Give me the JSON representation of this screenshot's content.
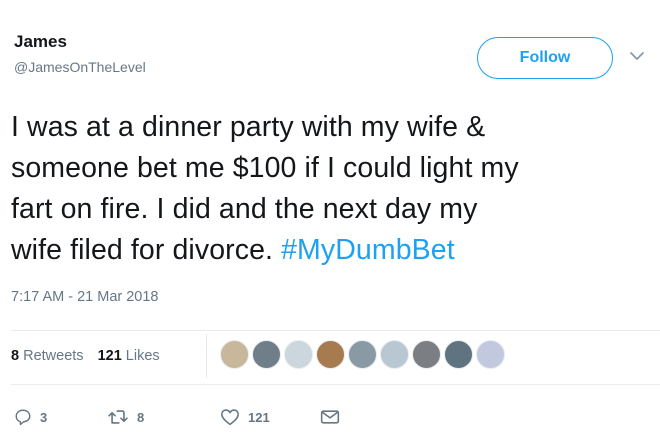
{
  "tweet": {
    "display_name": "James",
    "handle": "@JamesOnTheLevel",
    "follow_label": "Follow",
    "text_lines": [
      "I was at a dinner party with my wife &",
      "someone bet me $100 if I could light my",
      "fart on fire. I did and the next day my",
      "wife filed for divorce. "
    ],
    "hashtag": "#MyDumbBet",
    "timestamp": "7:17 AM - 21 Mar 2018"
  },
  "stats": {
    "retweets_count": "8",
    "retweets_label": "Retweets",
    "likes_count": "121",
    "likes_label": "Likes"
  },
  "liker_avatars": [
    "#c9b79c",
    "#6f7e88",
    "#ccd6dd",
    "#a87a4f",
    "#8a9aa5",
    "#b9c7d3",
    "#7b7f83",
    "#5f7380",
    "#c2c8de"
  ],
  "actions": {
    "reply_count": "3",
    "retweet_count": "8",
    "like_count": "121"
  },
  "colors": {
    "accent": "#1da1f2",
    "muted": "#657786",
    "text": "#14171a",
    "divider": "#e6ecf0"
  },
  "icons": [
    "chevron-down-icon",
    "reply-icon",
    "retweet-icon",
    "heart-icon",
    "envelope-icon"
  ]
}
